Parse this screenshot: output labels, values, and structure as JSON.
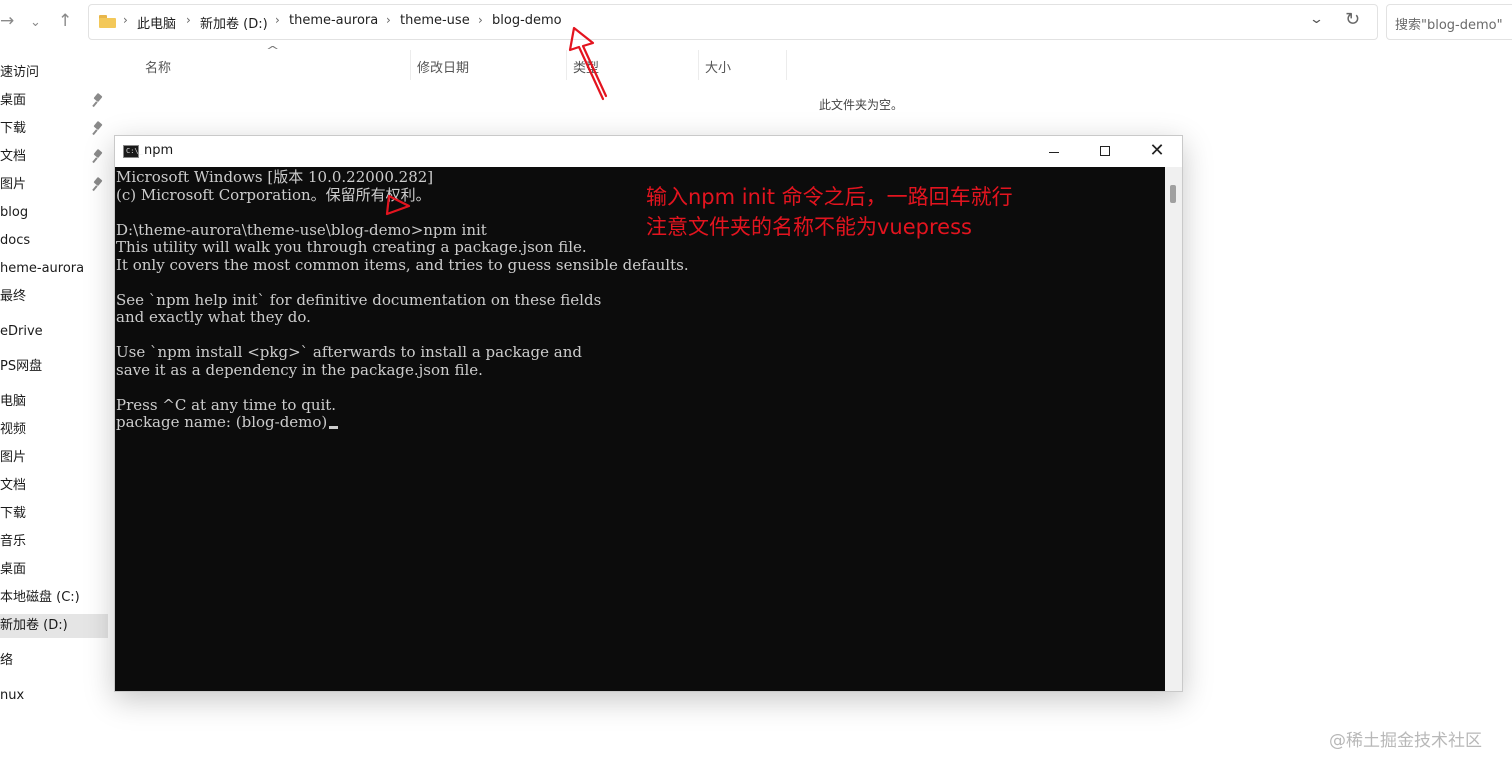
{
  "explorer": {
    "nav": {
      "forward_glyph": "→",
      "dropdown_glyph": "⌄",
      "up_glyph": "↑"
    },
    "breadcrumbs": [
      "此电脑",
      "新加卷 (D:)",
      "theme-aurora",
      "theme-use",
      "blog-demo"
    ],
    "breadcrumb_separator": "›",
    "refresh_glyph": "↻",
    "address_dropdown_glyph": "⌄",
    "search_placeholder": "搜索\"blog-demo\"",
    "columns": [
      "名称",
      "修改日期",
      "类型",
      "大小"
    ],
    "sort_glyph": "^",
    "empty_message": "此文件夹为空。",
    "sidebar": [
      {
        "label": "速访问",
        "pinned": false
      },
      {
        "label": "桌面",
        "pinned": true
      },
      {
        "label": "下载",
        "pinned": true
      },
      {
        "label": "文档",
        "pinned": true
      },
      {
        "label": "图片",
        "pinned": true
      },
      {
        "label": "blog",
        "pinned": false
      },
      {
        "label": "docs",
        "pinned": false
      },
      {
        "label": "heme-aurora",
        "pinned": false
      },
      {
        "label": "最终",
        "pinned": false
      },
      {
        "label": "eDrive",
        "pinned": false
      },
      {
        "label": "PS网盘",
        "pinned": false
      },
      {
        "label": "电脑",
        "pinned": false
      },
      {
        "label": "视频",
        "pinned": false
      },
      {
        "label": "图片",
        "pinned": false
      },
      {
        "label": "文档",
        "pinned": false
      },
      {
        "label": "下载",
        "pinned": false
      },
      {
        "label": "音乐",
        "pinned": false
      },
      {
        "label": "桌面",
        "pinned": false
      },
      {
        "label": "本地磁盘 (C:)",
        "pinned": false
      },
      {
        "label": "新加卷 (D:)",
        "pinned": false,
        "selected": true
      },
      {
        "label": "络",
        "pinned": false
      },
      {
        "label": "nux",
        "pinned": false
      }
    ]
  },
  "console": {
    "title": "npm",
    "icon_text": "C:\\_",
    "buttons": {
      "close": "✕"
    },
    "lines": [
      "Microsoft Windows [版本 10.0.22000.282]",
      "(c) Microsoft Corporation。保留所有权利。",
      "",
      "D:\\theme-aurora\\theme-use\\blog-demo>npm init",
      "This utility will walk you through creating a package.json file.",
      "It only covers the most common items, and tries to guess sensible defaults.",
      "",
      "See `npm help init` for definitive documentation on these fields",
      "and exactly what they do.",
      "",
      "Use `npm install <pkg>` afterwards to install a package and",
      "save it as a dependency in the package.json file.",
      "",
      "Press ^C at any time to quit.",
      "package name: (blog-demo)"
    ],
    "annotation": [
      "输入npm init 命令之后，一路回车就行",
      "注意文件夹的名称不能为vuepress"
    ]
  },
  "watermark": "@稀土掘金技术社区",
  "colors": {
    "annotation_red": "#e3141f",
    "console_bg": "#0c0c0c",
    "console_text": "#cccccc",
    "folder_yellow": "#f3c859"
  }
}
